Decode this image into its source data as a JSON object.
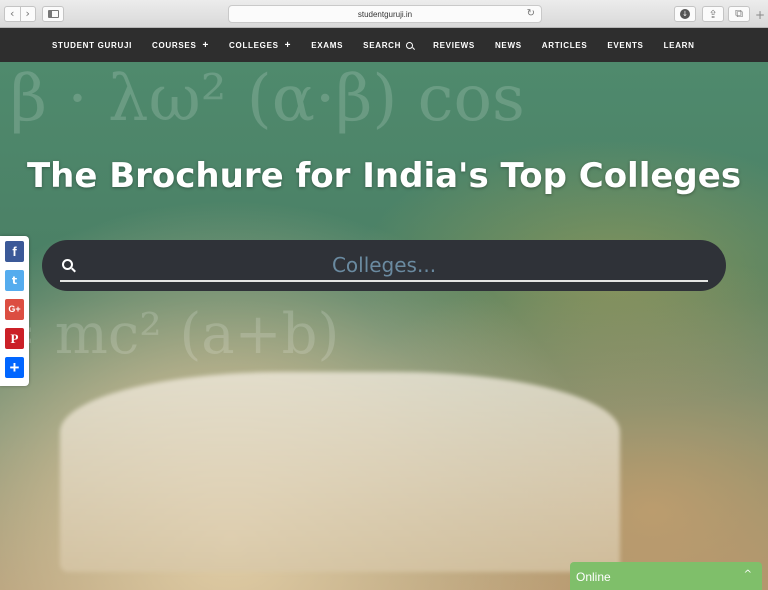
{
  "browser": {
    "url": "studentguruji.in",
    "back_glyph": "‹",
    "forward_glyph": "›",
    "reload_glyph": "↻",
    "download_glyph": "↓",
    "share_glyph": "⇪",
    "tabs_glyph": "⧉",
    "newtab_glyph": "+"
  },
  "nav": {
    "brand": "STUDENT GURUJI",
    "courses": "COURSES",
    "colleges": "COLLEGES",
    "plus": "+",
    "exams": "EXAMS",
    "search": "SEARCH",
    "reviews": "REVIEWS",
    "news": "NEWS",
    "articles": "ARTICLES",
    "events": "EVENTS",
    "learn": "LEARN"
  },
  "hero": {
    "title": "The Brochure for India's Top Colleges",
    "search_placeholder": "Colleges..."
  },
  "social": {
    "facebook": "f",
    "twitter": "t",
    "google_plus": "G+",
    "pinterest": "P",
    "share_more": "+"
  },
  "chat": {
    "status": "Online",
    "chevron": "^"
  },
  "colors": {
    "nav_bg": "#2e2e2e",
    "search_bg": "#2f3238",
    "chat_bg": "#7fbf6a",
    "facebook": "#3b5998",
    "twitter": "#55acee",
    "google_plus": "#dc4e41",
    "pinterest": "#cb2027",
    "share": "#0166ff"
  }
}
